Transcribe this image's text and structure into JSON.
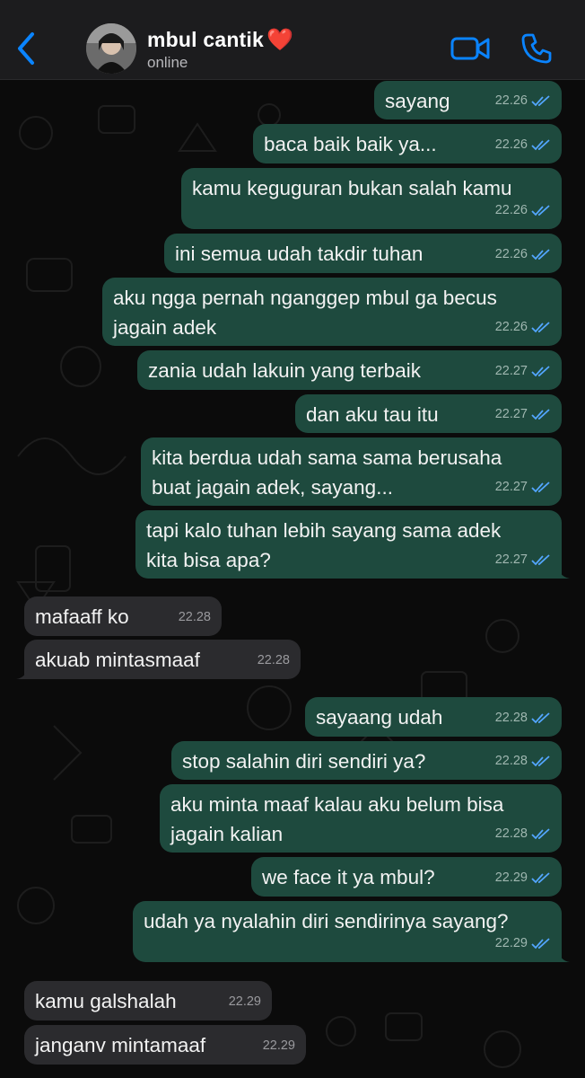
{
  "header": {
    "contact_name": "mbul cantik",
    "heart": "❤️",
    "status": "online",
    "icons": [
      "chevron-left-icon",
      "avatar",
      "video-icon",
      "phone-icon"
    ],
    "accent_color": "#0a84ff"
  },
  "messages": [
    {
      "dir": "out",
      "text": "sayang",
      "time": "22.26"
    },
    {
      "dir": "out",
      "text": "baca baik baik ya...",
      "time": "22.26"
    },
    {
      "dir": "out",
      "text": "kamu keguguran bukan salah kamu",
      "time": "22.26"
    },
    {
      "dir": "out",
      "text": "ini semua udah takdir tuhan",
      "time": "22.26"
    },
    {
      "dir": "out",
      "text": "aku ngga pernah nganggep mbul ga becus\njagain adek",
      "time": "22.26"
    },
    {
      "dir": "out",
      "text": "zania udah lakuin yang terbaik",
      "time": "22.27"
    },
    {
      "dir": "out",
      "text": "dan aku tau itu",
      "time": "22.27"
    },
    {
      "dir": "out",
      "text": "kita berdua udah sama sama berusaha\nbuat jagain adek, sayang...",
      "time": "22.27"
    },
    {
      "dir": "out",
      "text": "tapi kalo tuhan lebih sayang sama adek\nkita bisa apa?",
      "time": "22.27"
    },
    {
      "dir": "in",
      "text": "mafaaff ko",
      "time": "22.28"
    },
    {
      "dir": "in",
      "text": "akuab mintasmaaf",
      "time": "22.28"
    },
    {
      "dir": "out",
      "text": "sayaang udah",
      "time": "22.28"
    },
    {
      "dir": "out",
      "text": "stop salahin diri sendiri ya?",
      "time": "22.28"
    },
    {
      "dir": "out",
      "text": "aku minta maaf kalau aku belum bisa\njagain kalian",
      "time": "22.28"
    },
    {
      "dir": "out",
      "text": "we face it ya mbul?",
      "time": "22.29"
    },
    {
      "dir": "out",
      "text": "udah ya nyalahin diri sendirinya sayang?",
      "time": "22.29"
    },
    {
      "dir": "in",
      "text": "kamu galshalah",
      "time": "22.29"
    },
    {
      "dir": "in",
      "text": "janganv mintamaaf",
      "time": "22.29"
    }
  ],
  "colors": {
    "outgoing_bubble": "#1e4a3e",
    "incoming_bubble": "#2b2b2e",
    "read_tick": "#53a6ff"
  }
}
